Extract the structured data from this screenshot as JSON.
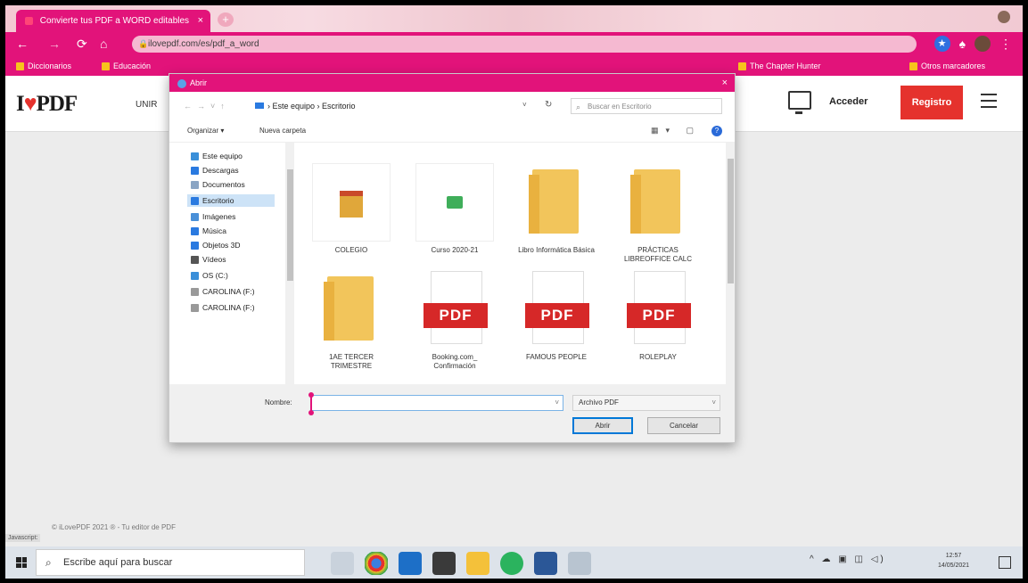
{
  "browser": {
    "tab_title": "Convierte tus PDF a WORD editables",
    "tab_close": "×",
    "new_tab": "+",
    "url": "ilovepdf.com/es/pdf_a_word",
    "bookmarks": [
      "Diccionarios",
      "Educación",
      "The Chapter Hunter",
      "Otros marcadores"
    ]
  },
  "site": {
    "logo_text": "PDF",
    "logo_prefix": "I",
    "unir_label": "UNIR",
    "acceder": "Acceder",
    "registro": "Registro",
    "footer": "© iLovePDF 2021 ® - Tu editor de PDF",
    "status": "Javascript:"
  },
  "dialog": {
    "title": "Abrir",
    "close": "×",
    "path": [
      "Este equipo",
      "Escritorio"
    ],
    "search_placeholder": "Buscar en Escritorio",
    "organize": "Organizar ▾",
    "new_folder": "Nueva carpeta",
    "help": "?",
    "nav_items": [
      {
        "label": "Este equipo",
        "color": "#3a8fd9"
      },
      {
        "label": "Descargas",
        "color": "#2a7ae0"
      },
      {
        "label": "Documentos",
        "color": "#8aa5c4"
      },
      {
        "label": "Escritorio",
        "color": "#2a7ae0"
      },
      {
        "label": "Imágenes",
        "color": "#4a90d8"
      },
      {
        "label": "Música",
        "color": "#2a7ae0"
      },
      {
        "label": "Objetos 3D",
        "color": "#2a7ae0"
      },
      {
        "label": "Vídeos",
        "color": "#555555"
      },
      {
        "label": "OS (C:)",
        "color": "#3a8fd9"
      },
      {
        "label": "CAROLINA (F:)",
        "color": "#999999"
      },
      {
        "label": "CAROLINA (F:)",
        "color": "#999999"
      }
    ],
    "files": [
      {
        "name": "COLEGIO",
        "kind": "app"
      },
      {
        "name": "Curso 2020-21",
        "kind": "app2"
      },
      {
        "name": "Libro Informática Básica",
        "kind": "folder"
      },
      {
        "name": "PRÁCTICAS LIBREOFFICE CALC",
        "kind": "folder"
      },
      {
        "name": "1AE TERCER TRIMESTRE",
        "kind": "folder"
      },
      {
        "name": "Booking.com_ Confirmación",
        "kind": "pdf"
      },
      {
        "name": "FAMOUS PEOPLE",
        "kind": "pdf"
      },
      {
        "name": "ROLEPLAY",
        "kind": "pdf"
      }
    ],
    "pdf_label": "PDF",
    "filename_label": "Nombre:",
    "filename_value": "",
    "filetype": "Archivo PDF",
    "open_button": "Abrir",
    "cancel_button": "Cancelar"
  },
  "taskbar": {
    "search_placeholder": "Escribe aquí para buscar",
    "time": "12:57",
    "date": "14/05/2021"
  }
}
